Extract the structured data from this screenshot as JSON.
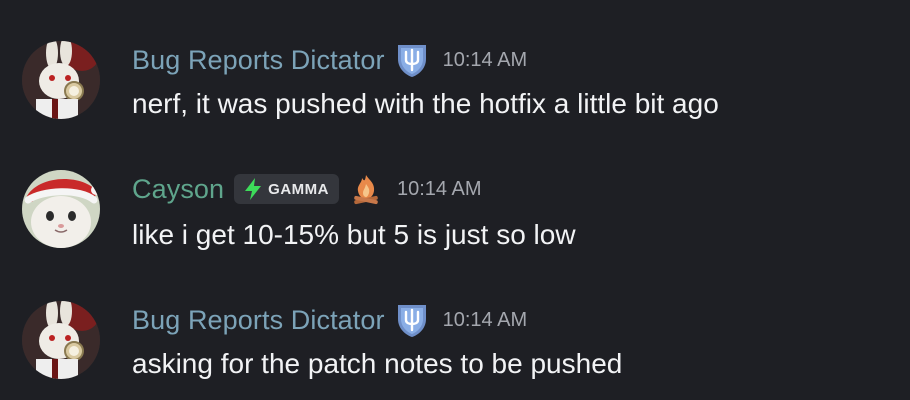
{
  "messages": [
    {
      "username": "Bug Reports Dictator",
      "username_color": "#7ca3b8",
      "role_icon": "shield-trident-icon",
      "timestamp": "10:14 AM",
      "text": "nerf, it was pushed with the hotfix a little bit ago",
      "avatar": "white-rabbit-avatar"
    },
    {
      "username": "Cayson",
      "username_color": "#5fa58c",
      "tag": {
        "icon": "lightning-bolt-icon",
        "label": "GAMMA",
        "icon_color": "#3ddc5a"
      },
      "status_icon": "campfire-icon",
      "timestamp": "10:14 AM",
      "text": "like i get 10-15% but 5 is just so low",
      "avatar": "cat-santa-hat-avatar"
    },
    {
      "username": "Bug Reports Dictator",
      "username_color": "#7ca3b8",
      "role_icon": "shield-trident-icon",
      "timestamp": "10:14 AM",
      "text": "asking for the patch notes to be pushed",
      "avatar": "white-rabbit-avatar"
    }
  ]
}
